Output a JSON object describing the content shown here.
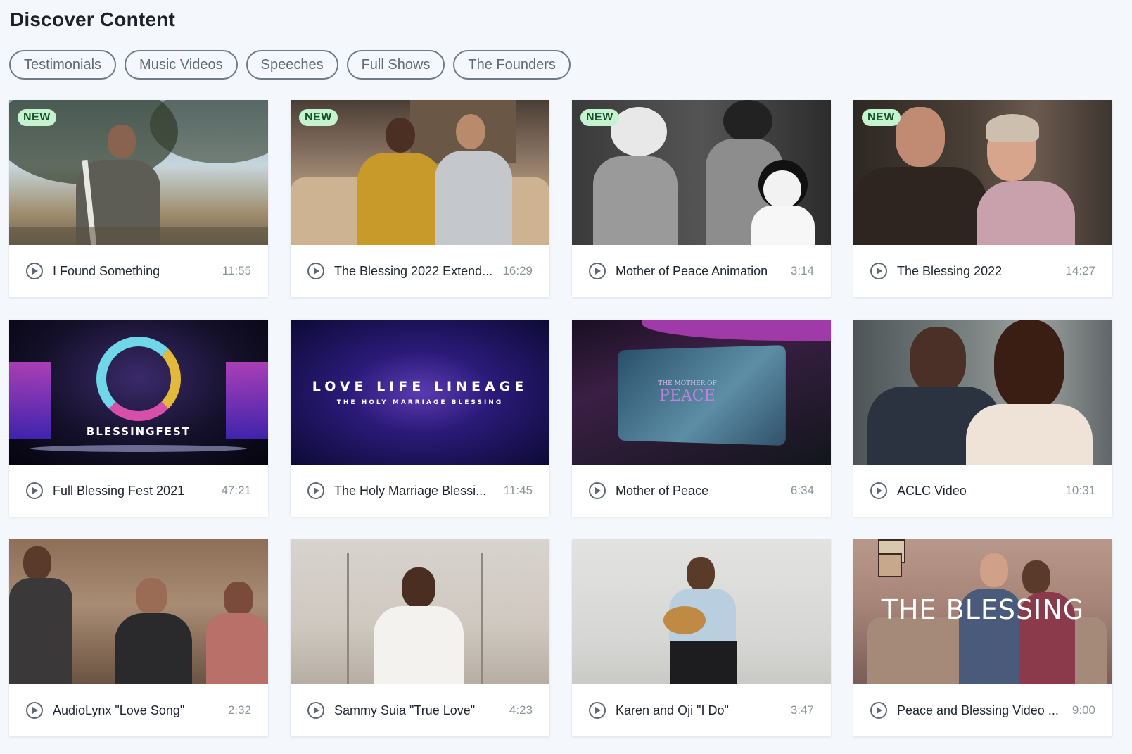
{
  "page": {
    "title": "Discover Content"
  },
  "filters": [
    "Testimonials",
    "Music Videos",
    "Speeches",
    "Full Shows",
    "The Founders"
  ],
  "colors": {
    "badge_bg": "#c6f3cf",
    "badge_text": "#16502a",
    "page_bg": "#f4f7fb"
  },
  "icons": {
    "play": "play-circle-icon"
  },
  "cards": [
    {
      "title": "I Found Something",
      "duration": "11:55",
      "badge": "NEW"
    },
    {
      "title": "The Blessing 2022 Extend...",
      "duration": "16:29",
      "badge": "NEW"
    },
    {
      "title": "Mother of Peace Animation",
      "duration": "3:14",
      "badge": "NEW"
    },
    {
      "title": "The Blessing 2022",
      "duration": "14:27",
      "badge": "NEW"
    },
    {
      "title": "Full Blessing Fest 2021",
      "duration": "47:21",
      "badge": "",
      "thumb_text": "BLESSINGFEST"
    },
    {
      "title": "The Holy Marriage Blessi...",
      "duration": "11:45",
      "badge": "",
      "thumb_text": "LOVE LIFE LINEAGE",
      "thumb_subtext": "THE HOLY MARRIAGE BLESSING"
    },
    {
      "title": "Mother of Peace",
      "duration": "6:34",
      "badge": "",
      "thumb_text": "THE MOTHER OF",
      "thumb_subtext": "PEACE"
    },
    {
      "title": "ACLC Video",
      "duration": "10:31",
      "badge": ""
    },
    {
      "title": "AudioLynx \"Love Song\"",
      "duration": "2:32",
      "badge": ""
    },
    {
      "title": "Sammy Suia \"True Love\"",
      "duration": "4:23",
      "badge": ""
    },
    {
      "title": "Karen and Oji \"I Do\"",
      "duration": "3:47",
      "badge": ""
    },
    {
      "title": "Peace and Blessing Video ...",
      "duration": "9:00",
      "badge": "",
      "thumb_text": "THE BLESSING"
    }
  ]
}
